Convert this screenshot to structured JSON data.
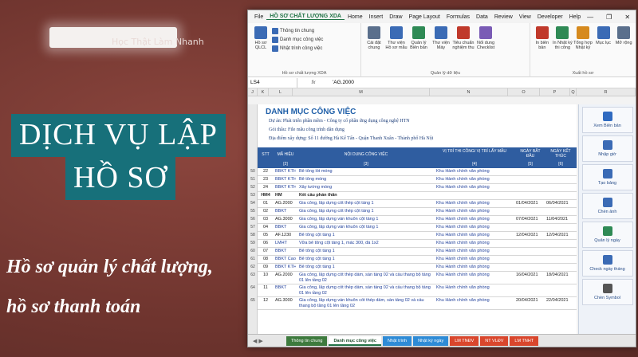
{
  "left": {
    "tagline": "Học Thật  Làm Nhanh",
    "service_line1": "DỊCH VỤ LẬP",
    "service_line2": "HỒ SƠ",
    "caption1": "Hồ sơ quản lý chất lượng,",
    "caption2": "hồ sơ thanh toán"
  },
  "excel": {
    "menu": [
      "File",
      "HỒ SƠ CHẤT LƯỢNG XDA",
      "Home",
      "Insert",
      "Draw",
      "Page Layout",
      "Formulas",
      "Data",
      "Review",
      "View",
      "Developer",
      "Help"
    ],
    "ribbon": {
      "hoso_btn": "Hồ sơ QLCL",
      "small": [
        "Thông tin chung",
        "Danh mục công việc",
        "Nhật trình công việc"
      ],
      "group1": "Hồ sơ chất lượng XDA",
      "buttons": [
        {
          "label": "Cài đặt chung",
          "color": "#5a6f8c"
        },
        {
          "label": "Thư viện Hồ sơ mẫu",
          "color": "#3b6bb5"
        },
        {
          "label": "Quản lý Biên bản",
          "color": "#2f8a55"
        },
        {
          "label": "Thư viện Máy",
          "color": "#3b6bb5"
        },
        {
          "label": "Tiêu chuẩn nghiệm thu",
          "color": "#c0392b"
        },
        {
          "label": "Nối dung Checklist",
          "color": "#7a5bb5"
        },
        {
          "label": "In biên bản",
          "color": "#c0392b"
        },
        {
          "label": "In Nhật ký thi công",
          "color": "#2f8a55"
        },
        {
          "label": "Tổng hợp Nhật ký",
          "color": "#d68a1e"
        },
        {
          "label": "Mục lục",
          "color": "#3b6bb5"
        },
        {
          "label": "Mở rộng",
          "color": "#5a6f8c"
        }
      ],
      "group2": "Quản lý dữ liệu",
      "group3": "Xuất hồ sơ"
    },
    "formula_bar": {
      "name_box": "LS4",
      "fx": "fx",
      "value": "'AG.2000"
    },
    "columns": [
      "J",
      "K",
      "L",
      "M",
      "N",
      "O",
      "P",
      "Q",
      "R"
    ],
    "sheet": {
      "title": "DANH MỤC CÔNG VIỆC",
      "project": "Dự án: Phát triển phần mềm - Công ty cổ phần ứng dụng công nghệ HTN",
      "package": "Gói thầu: File mẫu công trình dân dụng",
      "location": "Địa điểm xây dựng: Số 11 đường Hà Kế Tấn - Quận Thanh Xuân - Thành phố Hà Nội",
      "headers": {
        "stt": "STT",
        "code": "MÃ HIỆU",
        "desc": "NỘI DUNG CÔNG VIỆC",
        "loc": "VỊ TRÍ THI CÔNG/ VỊ TRÍ LẤY MẪU",
        "d1": "NGÀY BẮT ĐẦU",
        "d2": "NGÀY KẾT THÚC",
        "n1": "[1]",
        "n2": "[2]",
        "n3": "[3]",
        "n4": "[4]",
        "n5": "[5]",
        "n6": "[6]"
      },
      "rows": [
        {
          "r": "50",
          "stt": "22",
          "code": "BBKT KTHH",
          "desc": "Bê tông lót móng",
          "loc": "Khu Hành chính văn phòng",
          "d1": "",
          "d2": ""
        },
        {
          "r": "51",
          "stt": "23",
          "code": "BBKT KTHH",
          "desc": "Bê tông móng",
          "loc": "Khu Hành chính văn phòng",
          "d1": "",
          "d2": ""
        },
        {
          "r": "52",
          "stt": "24",
          "code": "BBKT KTHH",
          "desc": "Xây tường móng",
          "loc": "Khu Hành chính văn phòng",
          "d1": "",
          "d2": ""
        },
        {
          "r": "53",
          "stt": "HM4",
          "code": "HM",
          "desc": "Kết cấu phần thân",
          "loc": "",
          "d1": "",
          "d2": ""
        },
        {
          "r": "54",
          "stt": "01",
          "code": "AG.2000",
          "desc": "Gia công, lắp dựng cốt thép cột tầng 1",
          "loc": "Khu Hành chính văn phòng",
          "d1": "01/04/2021",
          "d2": "06/04/2021"
        },
        {
          "r": "55",
          "stt": "02",
          "code": "BBKT",
          "desc": "Gia công, lắp dựng cốt thép cột tầng 1",
          "loc": "Khu Hành chính văn phòng",
          "d1": "",
          "d2": ""
        },
        {
          "r": "56",
          "stt": "03",
          "code": "AG.3000",
          "desc": "Gia công, lắp dựng ván khuôn cột tầng 1",
          "loc": "Khu Hành chính văn phòng",
          "d1": "07/04/2021",
          "d2": "11/04/2021"
        },
        {
          "r": "57",
          "stt": "04",
          "code": "BBKT",
          "desc": "Gia công, lắp dựng ván khuôn cột tầng 1",
          "loc": "Khu Hành chính văn phòng",
          "d1": "",
          "d2": ""
        },
        {
          "r": "58",
          "stt": "05",
          "code": "AF.1230",
          "desc": "Bê tông cột tầng 1",
          "loc": "Khu Hành chính văn phòng",
          "d1": "12/04/2021",
          "d2": "12/04/2021"
        },
        {
          "r": "59",
          "stt": "06",
          "code": "LMHT",
          "desc": "Vữa bê tông cột tầng 1, mác 300, đá 1x2",
          "loc": "Khu Hành chính văn phòng",
          "d1": "",
          "d2": ""
        },
        {
          "r": "60",
          "stt": "07",
          "code": "BBKT",
          "desc": "Bê tông cột tầng 1",
          "loc": "Khu Hành chính văn phòng",
          "d1": "",
          "d2": ""
        },
        {
          "r": "61",
          "stt": "08",
          "code": "BBKT Caodo",
          "desc": "Bê tông cột tầng 1",
          "loc": "Khu Hành chính văn phòng",
          "d1": "",
          "d2": ""
        },
        {
          "r": "62",
          "stt": "09",
          "code": "BBKT KTHH",
          "desc": "Bê tông cột tầng 1",
          "loc": "Khu Hành chính văn phòng",
          "d1": "",
          "d2": ""
        },
        {
          "r": "63",
          "stt": "10",
          "code": "AG.2000",
          "desc": "Gia công, lắp dựng cốt thép dầm, sàn tầng 02 và cầu thang bộ tầng 01 lên tầng 02",
          "loc": "Khu Hành chính văn phòng",
          "d1": "16/04/2021",
          "d2": "18/04/2021"
        },
        {
          "r": "64",
          "stt": "11",
          "code": "BBKT",
          "desc": "Gia công, lắp dựng cốt thép dầm, sàn tầng 02 và cầu thang bộ tầng 01 lên tầng 02",
          "loc": "Khu Hành chính văn phòng",
          "d1": "",
          "d2": ""
        },
        {
          "r": "65",
          "stt": "12",
          "code": "AG.3000",
          "desc": "Gia công, lắp dựng ván khuôn cốt thép dầm, sàn tầng 02 và cầu thang bộ tầng 01 lên tầng 02",
          "loc": "Khu Hành chính văn phòng",
          "d1": "20/04/2021",
          "d2": "22/04/2021"
        }
      ]
    },
    "sidebar": [
      {
        "label": "Xem Biên bản",
        "color": "#2f6ac0"
      },
      {
        "label": "Nhập giờ",
        "color": "#3b6bb5"
      },
      {
        "label": "Tạo bảng",
        "color": "#3b6bb5"
      },
      {
        "label": "Chèn ảnh",
        "color": "#3b6bb5"
      },
      {
        "label": "Quản lý ngày",
        "color": "#2f8a55"
      },
      {
        "label": "Check ngày tháng",
        "color": "#3b6bb5"
      },
      {
        "label": "Chèn Symbol",
        "color": "#555555"
      }
    ],
    "tabs": [
      {
        "label": "Thông tin chung",
        "color": "#3d7a3d"
      },
      {
        "label": "Danh mục công việc",
        "color": "#ffffff",
        "active": true
      },
      {
        "label": "Nhật trình",
        "color": "#2e8bd6"
      },
      {
        "label": "Nhật ký ngày",
        "color": "#2e8bd6"
      },
      {
        "label": "LM TNĐV",
        "color": "#d9462c"
      },
      {
        "label": "NT VLĐV",
        "color": "#d9462c"
      },
      {
        "label": "LM TNHT",
        "color": "#d9462c"
      }
    ]
  }
}
